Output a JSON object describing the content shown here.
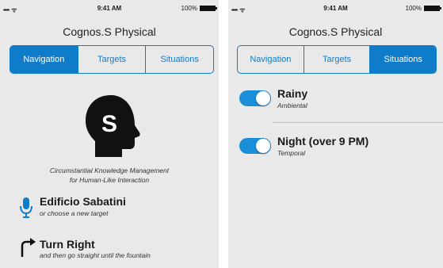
{
  "status_bar": {
    "signal": "•••••",
    "wifi_icon": "wifi-icon",
    "time": "9:41 AM",
    "battery_pct": "100%"
  },
  "app": {
    "title": "Cognos.S Physical"
  },
  "tabs": [
    "Navigation",
    "Targets",
    "Situations"
  ],
  "navigation_screen": {
    "active_tab": 0,
    "tagline_line1": "Circumstantial Knowledge Management",
    "tagline_line2": "for Human-Like Interaction",
    "logo_letter": "S",
    "target": {
      "title": "Edificio Sabatini",
      "subtitle": "or choose a new target",
      "icon": "microphone-icon"
    },
    "direction": {
      "title": "Turn Right",
      "subtitle": "and then go straight until the fountain",
      "icon": "turn-right-arrow-icon"
    }
  },
  "situations_screen": {
    "active_tab": 2,
    "items": [
      {
        "title": "Rainy",
        "subtitle": "Ambiental",
        "enabled": true
      },
      {
        "title": "Night (over 9 PM)",
        "subtitle": "Temporal",
        "enabled": true
      }
    ]
  },
  "colors": {
    "accent": "#0e7cc8",
    "toggle_on": "#1a8fd8",
    "background": "#e9e9e9"
  }
}
